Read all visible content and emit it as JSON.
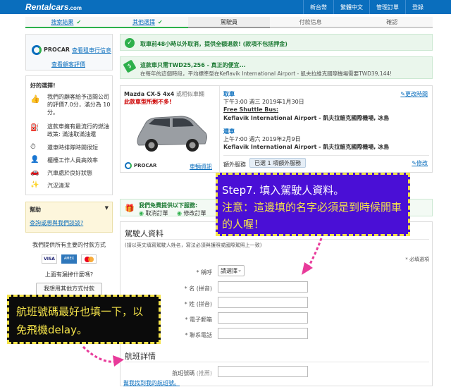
{
  "header": {
    "logo": "Rentalcars",
    "logo_suffix": ".com",
    "nav": [
      "新台幣",
      "繁體中文",
      "管理訂單",
      "登錄"
    ]
  },
  "steps": [
    {
      "label": "搜索結果",
      "done": true
    },
    {
      "label": "其他選擇",
      "done": true
    },
    {
      "label": "駕駛員",
      "current": true
    },
    {
      "label": "付款信息"
    },
    {
      "label": "確認"
    }
  ],
  "supplier": {
    "name": "PROCAR",
    "terms_link": "查看租車行信息",
    "reviews_link": "查看顧客評價"
  },
  "good_choice": {
    "title": "好的選擇!",
    "items": [
      "我們的顧客給予這間公司的評價7.0分，滿分為 10分。",
      "這款車擁有最流行的燃油政策: 滿油取滿油還",
      "還車時排隊時間很短",
      "櫃檯工作人員高效率",
      "汽車處於良好狀態",
      "汽況清潔"
    ]
  },
  "help": {
    "title": "幫助",
    "link": "查詢或想與我們談談?"
  },
  "payment": {
    "title": "我們提供所有主要的付款方式",
    "cards": [
      "VISA",
      "AMEX",
      "MC"
    ],
    "question": "上面有漏掉什麼嗎?",
    "button": "我想用其他方式付款"
  },
  "notice1": "取車前48小時以外取消，提供全額退款! (款項不包括押金)",
  "notice2": {
    "title": "這款車只需TWD25,256 - 真正的便宜...",
    "body": "在每年的這個時段，平均標準型在Keflavik International Airport - 凱夫拉維克國際機場需要TWD39,144!"
  },
  "car": {
    "model": "Mazda CX-5 4x4",
    "model_suffix": "或相似車輛",
    "warning": "此款車型所剩不多!",
    "supplier": "PROCAR",
    "details_link": "車輛資訊",
    "pickup_title": "取車",
    "pickup_time": "下午3:00 週三 2019年1月30日",
    "shuttle": "Free Shuttle Bus:",
    "pickup_loc": "Keflavik International Airport - 凱夫拉維克國際機場, 冰島",
    "dropoff_title": "還車",
    "dropoff_time": "上午7:00 週六 2019年2月9日",
    "dropoff_loc": "Keflavik International Airport - 凱夫拉維克國際機場, 冰島",
    "change_link": "更改時間",
    "extras_label": "額外服務",
    "extras_value": "已選 1 項額外服務",
    "edit_link": "修改"
  },
  "free_box": {
    "title": "我們免費提供以下服務:",
    "items": [
      "取消訂單",
      "修改訂單"
    ]
  },
  "form": {
    "title": "駕駛人資料",
    "subtitle": "(請以英文填寫駕駛人姓名，寫法必須與護照或國際駕照上一致)",
    "required_note": "* 必填選項",
    "title_label": "* 稱呼",
    "title_select": "請選擇",
    "first_name": "* 名 (拼音)",
    "last_name": "* 姓 (拼音)",
    "email": "* 電子郵箱",
    "phone": "* 聯系電話",
    "flight_title": "航班詳情",
    "flight_label": "航班號碼",
    "flight_hint": "(推薦)",
    "flight_link": "幫我找到我的航班號。"
  },
  "annotations": {
    "step7_line1": "Step7. 填入駕駛人資料。",
    "step7_line2": "注意：這邊填的名字必須是到時候開車的人喔！",
    "flight_note": "航班號碼最好也填一下，以免飛機delay。"
  },
  "colors": {
    "brand_blue": "#0a6ebd",
    "green": "#2db04b",
    "annot_purple": "#4a0fd6",
    "annot_black": "#0b0b0b",
    "annot_yellow": "#f4e34a",
    "arrow_pink": "#e83a9a"
  }
}
